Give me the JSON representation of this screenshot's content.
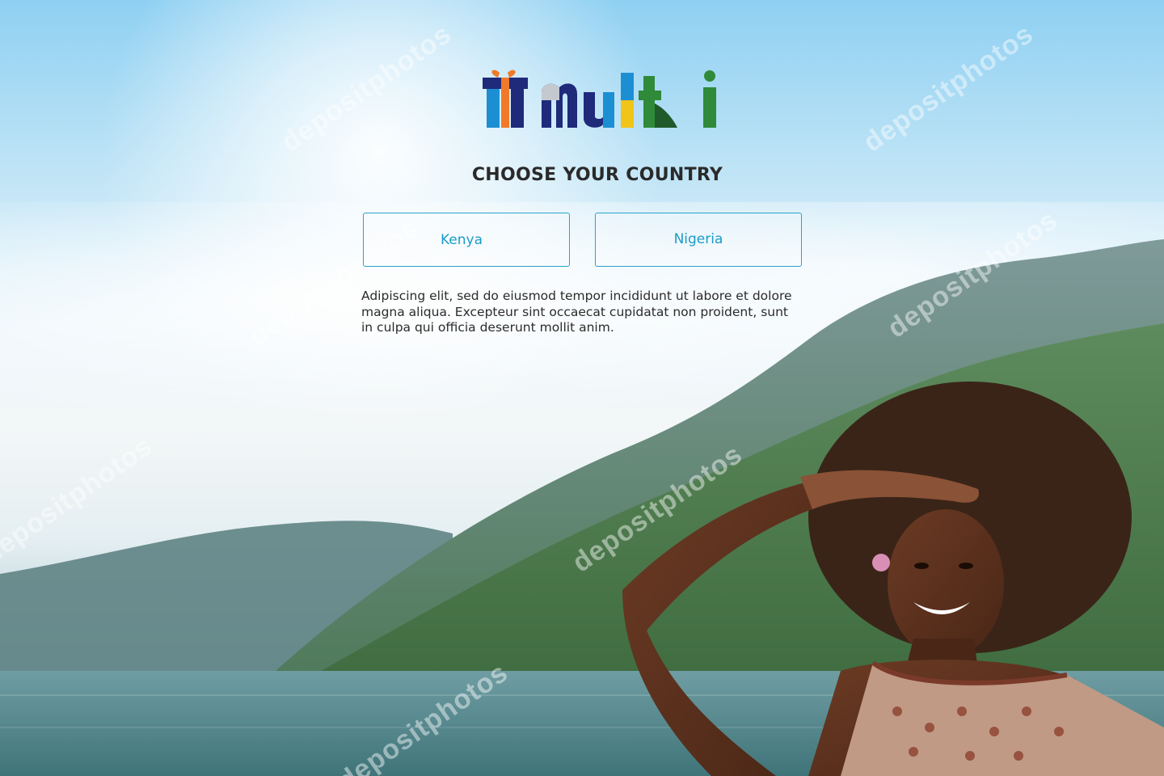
{
  "brand": {
    "logo_text": "multi",
    "colors": {
      "navy": "#1f2a7a",
      "blue": "#1c8fd3",
      "orange": "#f07a2a",
      "yellow": "#f0c419",
      "green": "#2f8a3a",
      "accent": "#1a9cc8"
    }
  },
  "main": {
    "title": "CHOOSE YOUR COUNTRY",
    "countries": [
      {
        "label": "Kenya"
      },
      {
        "label": "Nigeria"
      }
    ],
    "description": "Adipiscing elit, sed do eiusmod tempor incididunt ut labore et dolore magna aliqua.  Excepteur sint occaecat cupidatat non proident, sunt in culpa qui officia deserunt mollit anim."
  },
  "background": {
    "watermark_text": "depositphotos"
  }
}
